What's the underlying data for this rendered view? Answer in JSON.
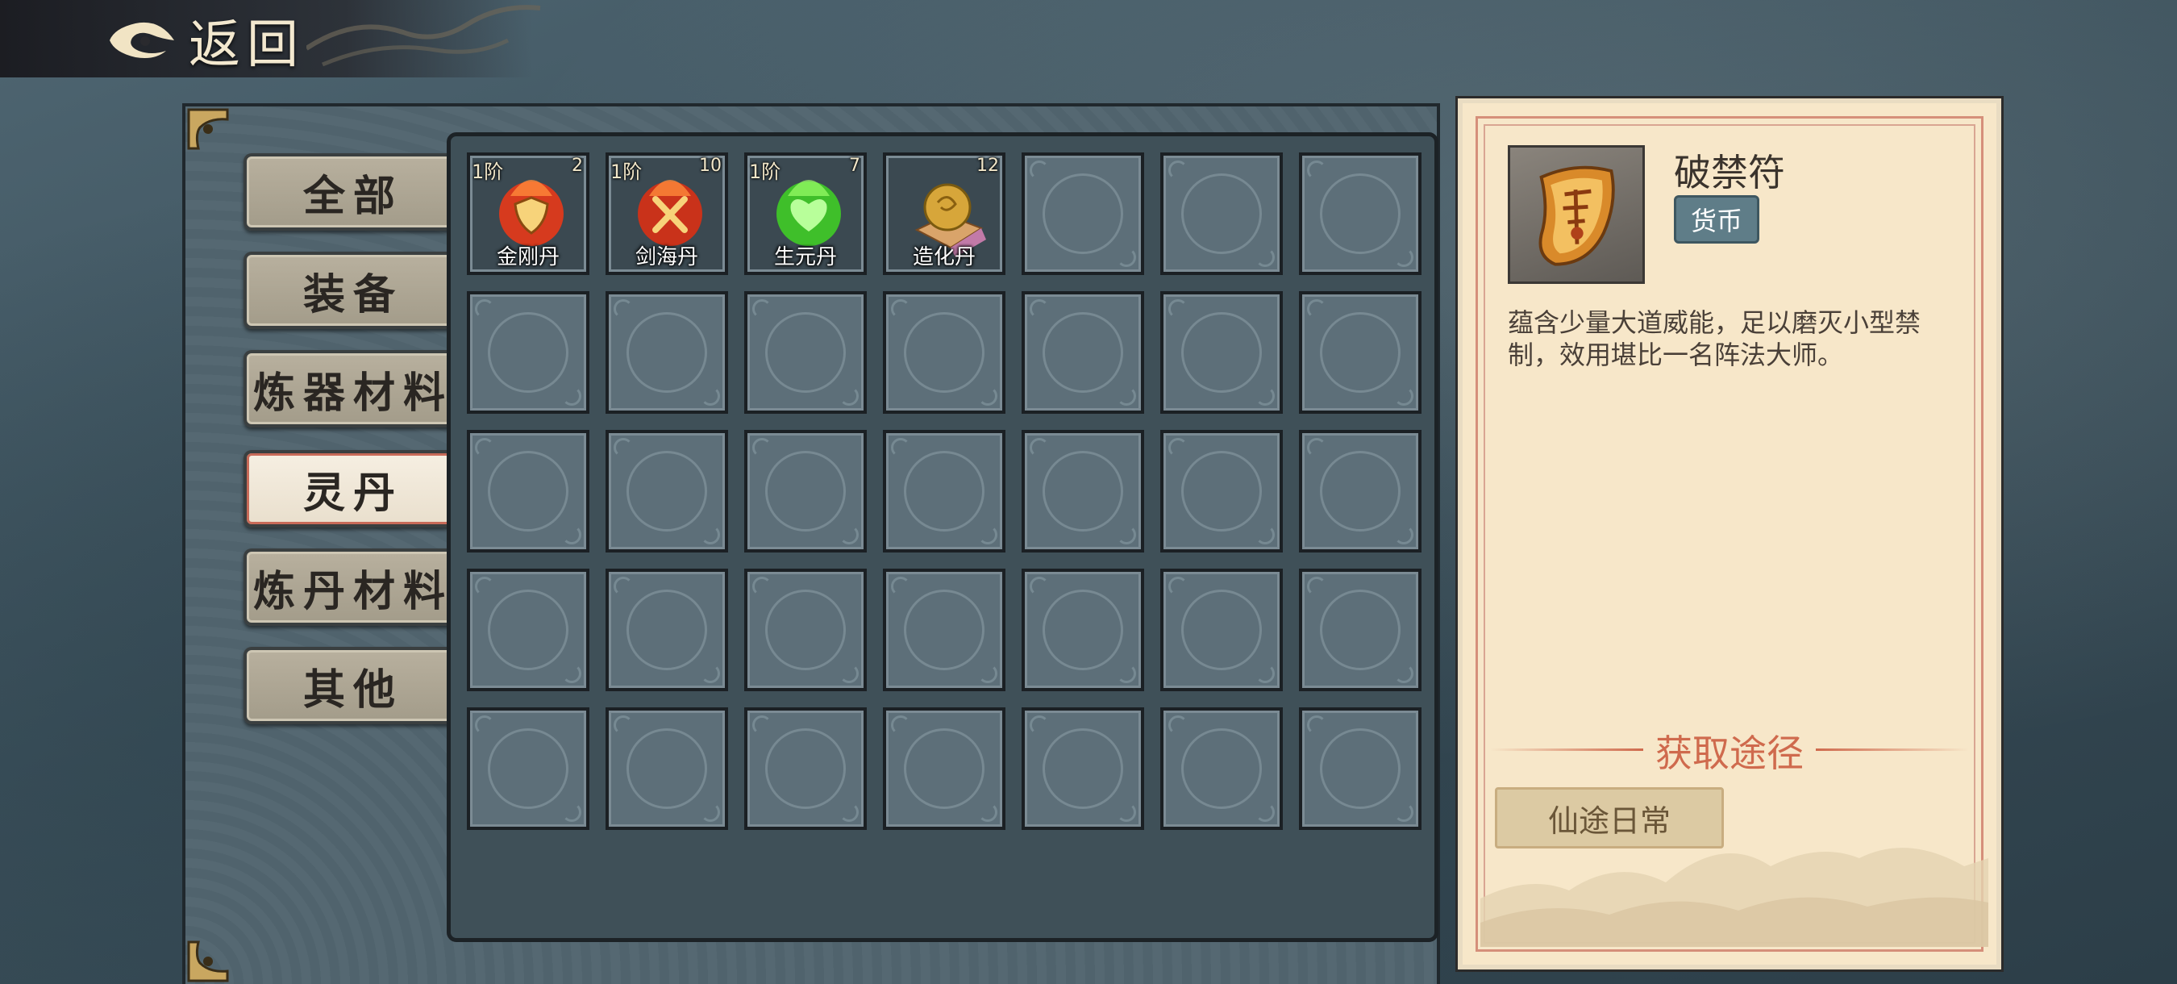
{
  "header": {
    "back_label": "返回"
  },
  "tabs": [
    {
      "label": "全部",
      "active": false
    },
    {
      "label": "装备",
      "active": false
    },
    {
      "label": "炼器材料",
      "active": false
    },
    {
      "label": "灵丹",
      "active": true
    },
    {
      "label": "炼丹材料",
      "active": false
    },
    {
      "label": "其他",
      "active": false
    }
  ],
  "inventory": {
    "columns": 7,
    "rows": 5,
    "items": [
      {
        "tier": "1阶",
        "count": "2",
        "name": "金刚丹",
        "icon": "shield-pill-icon",
        "color": "#d63a1e"
      },
      {
        "tier": "1阶",
        "count": "10",
        "name": "剑海丹",
        "icon": "sword-pill-icon",
        "color": "#c9321a"
      },
      {
        "tier": "1阶",
        "count": "7",
        "name": "生元丹",
        "icon": "heart-pill-icon",
        "color": "#3fbf2a"
      },
      {
        "tier": "",
        "count": "12",
        "name": "造化丹",
        "icon": "golden-orb-icon",
        "color": "#d7a63a"
      }
    ]
  },
  "detail": {
    "name": "破禁符",
    "type": "货币",
    "icon": "talisman-scroll-icon",
    "description": "蕴含少量大道威能，足以磨灭小型禁制，效用堪比一名阵法大师。",
    "source_title": "获取途径",
    "source_button": "仙途日常"
  }
}
